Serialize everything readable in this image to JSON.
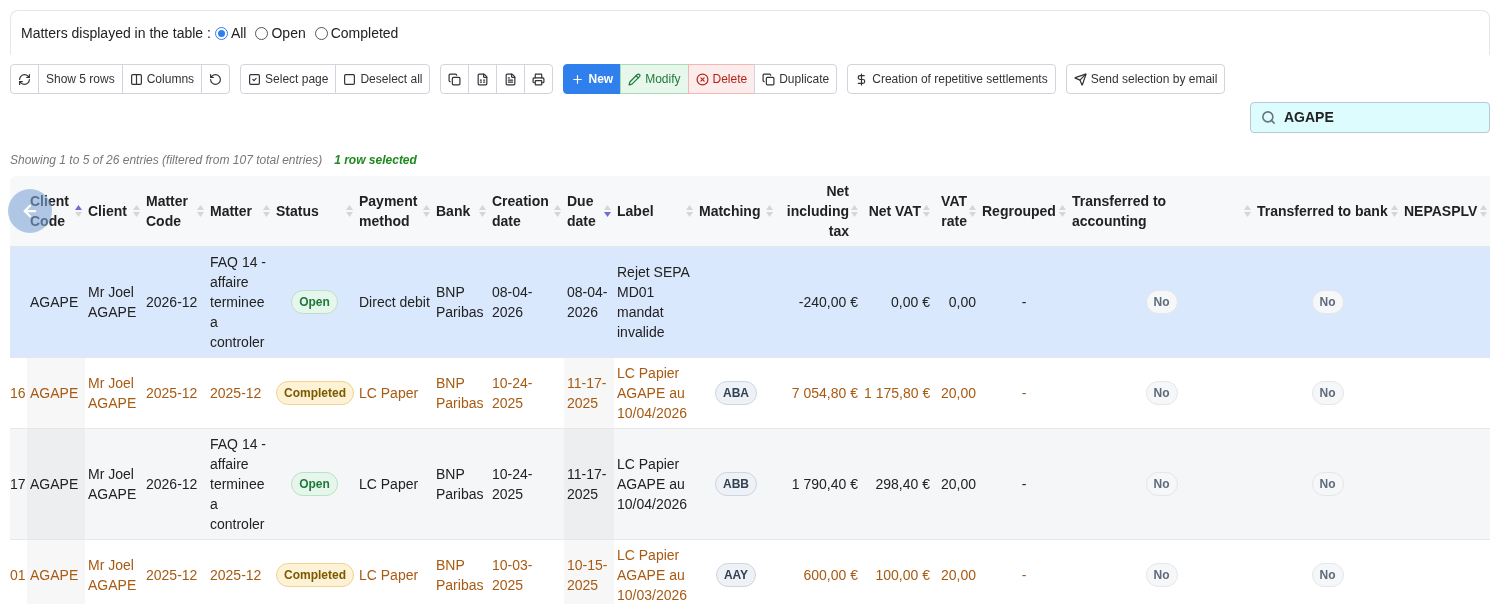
{
  "filter": {
    "label": "Matters displayed in the table :",
    "options": [
      {
        "label": "All",
        "selected": true
      },
      {
        "label": "Open",
        "selected": false
      },
      {
        "label": "Completed",
        "selected": false
      }
    ]
  },
  "toolbar": [
    {
      "group": [
        {
          "kind": "refresh"
        },
        {
          "kind": "text",
          "label": "Show 5 rows"
        },
        {
          "kind": "columns",
          "label": "Columns"
        },
        {
          "kind": "undo"
        }
      ]
    },
    {
      "group": [
        {
          "kind": "select",
          "label": "Select page"
        },
        {
          "kind": "deselect",
          "label": "Deselect all"
        }
      ]
    },
    {
      "group": [
        {
          "kind": "copy"
        },
        {
          "kind": "excel"
        },
        {
          "kind": "pdf"
        },
        {
          "kind": "print"
        }
      ]
    },
    {
      "group": [
        {
          "kind": "new",
          "label": "New"
        },
        {
          "kind": "modify",
          "label": "Modify"
        },
        {
          "kind": "delete",
          "label": "Delete"
        },
        {
          "kind": "duplicate",
          "label": "Duplicate"
        }
      ]
    },
    {
      "group": [
        {
          "kind": "repeat",
          "label": "Creation of repetitive settlements"
        }
      ]
    },
    {
      "group": [
        {
          "kind": "email",
          "label": "Send selection by email"
        }
      ]
    }
  ],
  "search": {
    "value": "AGAPE"
  },
  "info": {
    "text": "Showing 1 to 5 of 26 entries (filtered from 107 total entries)",
    "selection": "1 row selected"
  },
  "table": {
    "columns": [
      {
        "label": "Client Code",
        "sorted_ascending": true,
        "sorted_descending": false
      },
      {
        "label": "Client",
        "sorted_ascending": false,
        "sorted_descending": false
      },
      {
        "label": "Matter Code",
        "sorted_ascending": false,
        "sorted_descending": false
      },
      {
        "label": "Matter",
        "sorted_ascending": false,
        "sorted_descending": false
      },
      {
        "label": "Status",
        "sorted_ascending": false,
        "sorted_descending": false
      },
      {
        "label": "Payment method",
        "sorted_ascending": false,
        "sorted_descending": false
      },
      {
        "label": "Bank",
        "sorted_ascending": false,
        "sorted_descending": false
      },
      {
        "label": "Creation date",
        "sorted_ascending": false,
        "sorted_descending": false
      },
      {
        "label": "Due date",
        "sorted_ascending": false,
        "sorted_descending": true
      },
      {
        "label": "Label",
        "sorted_ascending": false,
        "sorted_descending": false
      },
      {
        "label": "Matching",
        "sorted_ascending": false,
        "sorted_descending": false
      },
      {
        "label": "Net including tax",
        "sorted_ascending": false,
        "sorted_descending": false
      },
      {
        "label": "Net VAT",
        "sorted_ascending": false,
        "sorted_descending": false
      },
      {
        "label": "VAT rate",
        "sorted_ascending": false,
        "sorted_descending": false
      },
      {
        "label": "Regrouped",
        "sorted_ascending": false,
        "sorted_descending": false
      },
      {
        "label": "Transferred to accounting",
        "sorted_ascending": false,
        "sorted_descending": false
      },
      {
        "label": "Transferred to bank",
        "sorted_ascending": false,
        "sorted_descending": false
      },
      {
        "label": "NEPASPLV",
        "sorted_ascending": false,
        "sorted_descending": false
      }
    ],
    "rows": [
      {
        "selected": true,
        "cells": [
          "AGAPE",
          "Mr Joel AGAPE",
          "2026-12",
          "FAQ 14 - affaire terminee a controler",
          {
            "status": "Open",
            "kind": "open"
          },
          "Direct debit",
          "BNP Paribas",
          "08-04-2026",
          "08-04-2026",
          "Rejet SEPA MD01 mandat invalide",
          null,
          "-240,00 €",
          "0,00 €",
          "0,00",
          "-",
          "No",
          "No"
        ]
      },
      {
        "selected": false,
        "column_1": "16",
        "cells": [
          "AGAPE",
          "Mr Joel AGAPE",
          "2025-12",
          "2025-12",
          {
            "status": "Completed",
            "kind": "completed"
          },
          "LC Paper",
          "BNP Paribas",
          "10-24-2025",
          "11-17-2025",
          "LC Papier AGAPE au 10/04/2026",
          "ABA",
          "7 054,80 €",
          "1 175,80 €",
          "20,00",
          "-",
          "No",
          "No"
        ]
      },
      {
        "selected": false,
        "column_1": "17",
        "cells": [
          "AGAPE",
          "Mr Joel AGAPE",
          "2026-12",
          "FAQ 14 - affaire terminee a controler",
          {
            "status": "Open",
            "kind": "open"
          },
          "LC Paper",
          "BNP Paribas",
          "10-24-2025",
          "11-17-2025",
          "LC Papier AGAPE au 10/04/2026",
          "ABB",
          "1 790,40 €",
          "298,40 €",
          "20,00",
          "-",
          "No",
          "No"
        ]
      },
      {
        "selected": false,
        "column_1": "01",
        "cells": [
          "AGAPE",
          "Mr Joel AGAPE",
          "2025-12",
          "2025-12",
          {
            "status": "Completed",
            "kind": "completed"
          },
          "LC Paper",
          "BNP Paribas",
          "10-03-2025",
          "10-15-2025",
          "LC Papier AGAPE au 10/03/2026",
          "AAY",
          "600,00 €",
          "100,00 €",
          "20,00",
          "-",
          "No",
          "No"
        ]
      }
    ]
  }
}
